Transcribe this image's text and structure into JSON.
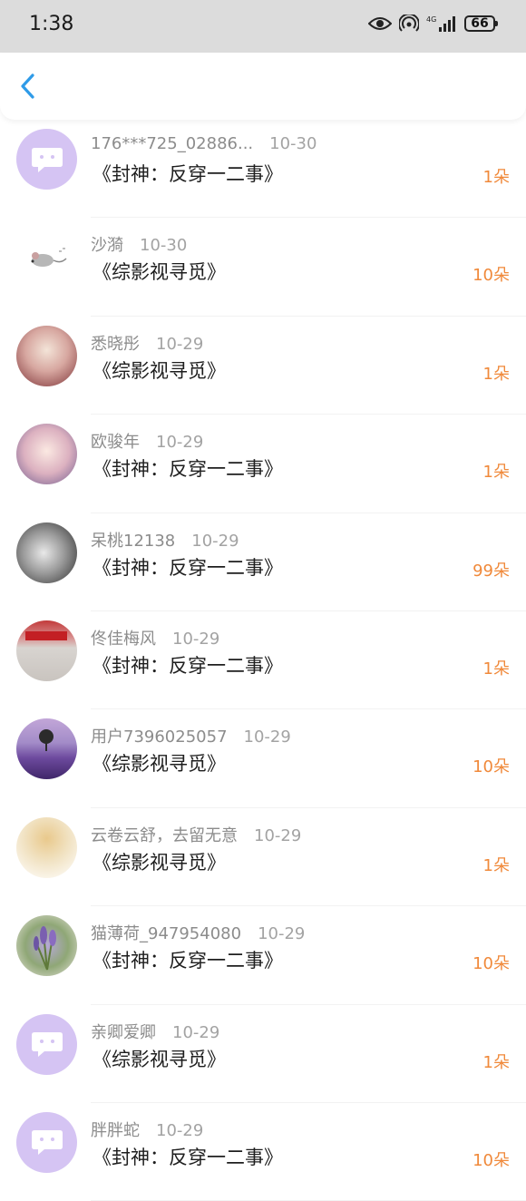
{
  "status_bar": {
    "time": "1:38",
    "battery": "66",
    "network": "4G",
    "icons": [
      "eye-icon",
      "hotspot-icon",
      "signal-icon",
      "battery-icon"
    ]
  },
  "header": {
    "back_icon": "chevron-left-icon"
  },
  "colors": {
    "accent": "#2f9be8",
    "amount": "#f0893a",
    "default_avatar": "#d5c4f3"
  },
  "items": [
    {
      "name": "176***725_02886...",
      "date": "10-30",
      "title": "《封神：反穿一二事》",
      "amount": "1朵",
      "avatar": "default"
    },
    {
      "name": "沙漪",
      "date": "10-30",
      "title": "《综影视寻觅》",
      "amount": "10朵",
      "avatar": "plain"
    },
    {
      "name": "悉晓彤",
      "date": "10-29",
      "title": "《综影视寻觅》",
      "amount": "1朵",
      "avatar": "a3"
    },
    {
      "name": "欧骏年",
      "date": "10-29",
      "title": "《封神：反穿一二事》",
      "amount": "1朵",
      "avatar": "a4"
    },
    {
      "name": "呆桃12138",
      "date": "10-29",
      "title": "《封神：反穿一二事》",
      "amount": "99朵",
      "avatar": "a5"
    },
    {
      "name": "佟佳梅风",
      "date": "10-29",
      "title": "《封神：反穿一二事》",
      "amount": "1朵",
      "avatar": "a6"
    },
    {
      "name": "用户7396025057",
      "date": "10-29",
      "title": "《综影视寻觅》",
      "amount": "10朵",
      "avatar": "a7"
    },
    {
      "name": "云卷云舒，去留无意",
      "date": "10-29",
      "title": "《综影视寻觅》",
      "amount": "1朵",
      "avatar": "a8"
    },
    {
      "name": "猫薄荷_947954080",
      "date": "10-29",
      "title": "《封神：反穿一二事》",
      "amount": "10朵",
      "avatar": "a9"
    },
    {
      "name": "亲卿爱卿",
      "date": "10-29",
      "title": "《综影视寻觅》",
      "amount": "1朵",
      "avatar": "default"
    },
    {
      "name": "胖胖蛇",
      "date": "10-29",
      "title": "《封神：反穿一二事》",
      "amount": "10朵",
      "avatar": "default"
    }
  ]
}
